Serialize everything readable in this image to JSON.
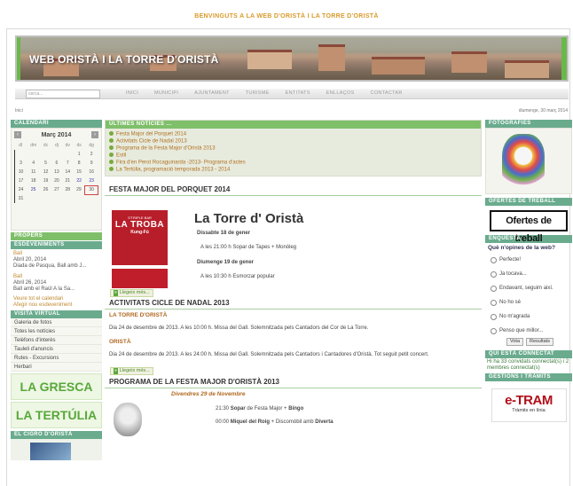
{
  "welcome": "BENVINGUTS A LA WEB D'ORISTÀ I LA TORRE D'ORISTÀ",
  "banner_title": "WEB ORISTÀ I LA TORRE D'ORISTÀ",
  "search_placeholder": "cerca...",
  "menu": [
    "INICI",
    "MUNICIPI",
    "AJUNTAMENT",
    "TURISME",
    "ENTITATS",
    "ENLLAÇOS",
    "CONTACTAR"
  ],
  "breadcrumb": "Inici",
  "date": "diumenge, 30 març 2014",
  "calendar": {
    "header": "CALENDARI",
    "month": "Març 2014",
    "weekdays": [
      "dl",
      "dm",
      "dc",
      "dj",
      "dv",
      "ds",
      "dg"
    ],
    "weeks": [
      [
        "",
        "",
        "",
        "",
        "",
        "1",
        "2"
      ],
      [
        "3",
        "4",
        "5",
        "6",
        "7",
        "8",
        "9"
      ],
      [
        "10",
        "11",
        "12",
        "13",
        "14",
        "15",
        "16"
      ],
      [
        "17",
        "18",
        "19",
        "20",
        "21",
        "22",
        "23"
      ],
      [
        "24",
        "25",
        "26",
        "27",
        "28",
        "29",
        "30"
      ],
      [
        "31",
        "",
        "",
        "",
        "",
        "",
        ""
      ]
    ]
  },
  "upcoming": {
    "header": "PROPERS",
    "subheader": "ESDEVENIMENTS",
    "events": [
      {
        "type": "Ball",
        "date": "Abril 20, 2014",
        "title": "Diada de Pasqua, Ball amb J..."
      },
      {
        "type": "Ball",
        "date": "Abril 26, 2014",
        "title": "Ball amb el Raül A la Sa..."
      }
    ],
    "link_calendar": "Veure tot el calendari",
    "link_add": "Afegir nou esdeveniment"
  },
  "virtual": {
    "header": "VISITA VIRTUAL",
    "items": [
      "Galeria de fotos",
      "Totes les notícies",
      "Telèfons d'interès",
      "Tauleli d'anuncis",
      "Rutes - Excursions",
      "Herbari"
    ]
  },
  "logos": [
    "LA GRESCA",
    "LA TERTÚLIA"
  ],
  "cigro_header": "EL CIGRÓ D'ORISTÀ",
  "news": {
    "header": "ÚLTIMES NOTÍCIES ...",
    "items": [
      "Festa Major del Porquet 2014",
      "Activitats Cicle de Nadal 2013",
      "Programa de la Festa Major d'Oristà 2013",
      "Estil",
      "Fira d'en Perot Rocaguinarda -2013- Programa d'actes",
      "La Tertúlia, programació temporada 2013 - 2014"
    ]
  },
  "article1": {
    "title": "FESTA MAJOR DEL PORQUET 2014",
    "heading": "La Torre d' Oristà",
    "day1": "Dissabte 18 de gener",
    "item1": "A les 21:00 h  Sopar de Tapes + Monòleg",
    "day2": "Diumenge 19 de gener",
    "item2": "A les 10:30 h Esmorzar popular",
    "poster_small": "S'TRIPLE BAR",
    "poster_big": "LA TROBA",
    "poster_mid": "Kung-Fú",
    "more": "Llegeix més..."
  },
  "article2": {
    "title": "ACTIVITATS CICLE DE NADAL 2013",
    "sub1": "LA TORRE D'ORISTÀ",
    "para1": "Dia 24 de desembre de 2013. A les 10:00 h. Missa del Gall. Solemnitzada pels  Cantadors del Cor de La Torre.",
    "sub2": "ORISTÀ",
    "para2": "Dia 24 de desembre de 2013. A les 24:00 h. Missa del Gall. Solemnitzada pels Cantadors i Cantadores d'Oristà. Tot seguit petit concert.",
    "more": "Llegeix més..."
  },
  "article3": {
    "title": "PROGRAMA DE LA FESTA MAJOR D'ORISTÀ 2013",
    "day": "Divendres 29 de Novembre",
    "item1_time": "21:30",
    "item1_a": "Sopar",
    "item1_b": " de Festa Major + ",
    "item1_c": "Bingo",
    "item2_time": "00:00",
    "item2_a": "Miquel del Roig",
    "item2_b": " + Discomòbil amb ",
    "item2_c": "Diverta"
  },
  "right": {
    "photos_header": "FOTOGRAFIES",
    "jobs_header": "OFERTES DE TREBALL",
    "jobs_label": "Ofertes de treball",
    "poll_header": "ENQUESTA",
    "poll_question": "Què n'opines de la web?",
    "poll_options": [
      "Perfecte!",
      "Ja tocava...",
      "Endavant, seguim així.",
      "No ho sé",
      "No m'agrada",
      "Penso que millor..."
    ],
    "vote": "Vota",
    "results": "Resultats",
    "online_header": "QUI ESTÀ CONNECTAT",
    "online_text": "Hi ha 33 convidats connectat(s) i 2 membres connectat(s)",
    "procedures_header": "GESTIONS I TRÀMITS",
    "etram_logo": "e-TRAM",
    "etram_sub": "Tràmits en línia"
  }
}
